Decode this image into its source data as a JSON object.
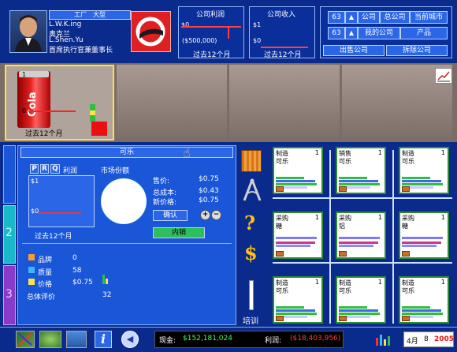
{
  "colors": {
    "accent": "#1a56d8",
    "status_green": "#3cff5a",
    "status_red": "#ff3b3b",
    "yellow": "#ffe24a"
  },
  "header": {
    "tab_label": "工厂　大型",
    "name_en_1": "L.W.K.ing",
    "name_cn_1": "奥克兰",
    "name_en_2": "L.Shen.Yu",
    "role": "首席执行官兼董事长",
    "profit_box": {
      "title": "公司利润",
      "top": "$0",
      "bottom": "($500,000)",
      "period": "过去12个月"
    },
    "revenue_box": {
      "title": "公司收入",
      "top": "$1",
      "bottom": "$0",
      "period": "过去12个月"
    },
    "nav": {
      "num1": "63",
      "num2": "63",
      "company": "公司",
      "hq": "总公司",
      "city": "当前城市",
      "my_company": "我的公司",
      "product": "产品",
      "sell_company": "出售公司",
      "demolish_company": "拆除公司"
    }
  },
  "strip": {
    "slot1_top": "1",
    "slot1_zero": "0",
    "slot1_period": "过去12个月"
  },
  "product_panel": {
    "title": "可乐",
    "tabs": [
      "P",
      "R",
      "Q"
    ],
    "profit_label": "利润",
    "market_share_label": "市场份额",
    "chart_top": "$1",
    "chart_bottom": "$0",
    "chart_period": "过去12个月",
    "price_label": "售价:",
    "price_value": "$0.75",
    "total_cost_label": "总成本:",
    "total_cost_value": "$0.43",
    "new_price_label": "新价格:",
    "new_price_value": "$0.75",
    "confirm_btn": "确认",
    "domestic_btn": "内销",
    "brand_label": "品牌",
    "brand_value": "0",
    "quality_label": "质量",
    "quality_value": "58",
    "price2_label": "价格",
    "price2_value": "$0.75",
    "overall_label": "总体评价",
    "overall_value": "32"
  },
  "tools": {
    "training_label": "培训"
  },
  "cards": [
    {
      "type": "制造",
      "num": "1",
      "item": "可乐"
    },
    {
      "type": "销售",
      "num": "1",
      "item": "可乐"
    },
    {
      "type": "制造",
      "num": "1",
      "item": "可乐"
    },
    {
      "type": "采购",
      "num": "1",
      "item": "糖"
    },
    {
      "type": "采购",
      "num": "1",
      "item": "铝"
    },
    {
      "type": "采购",
      "num": "1",
      "item": "糖"
    },
    {
      "type": "制造",
      "num": "1",
      "item": "可乐"
    },
    {
      "type": "制造",
      "num": "1",
      "item": "可乐"
    },
    {
      "type": "制造",
      "num": "1",
      "item": "可乐"
    }
  ],
  "status": {
    "cash_label": "现金:",
    "cash_value": "$152,181,024",
    "profit_label": "利润:",
    "profit_value": "($18,403,956)",
    "month": "4月",
    "day": "8",
    "year": "2005"
  }
}
